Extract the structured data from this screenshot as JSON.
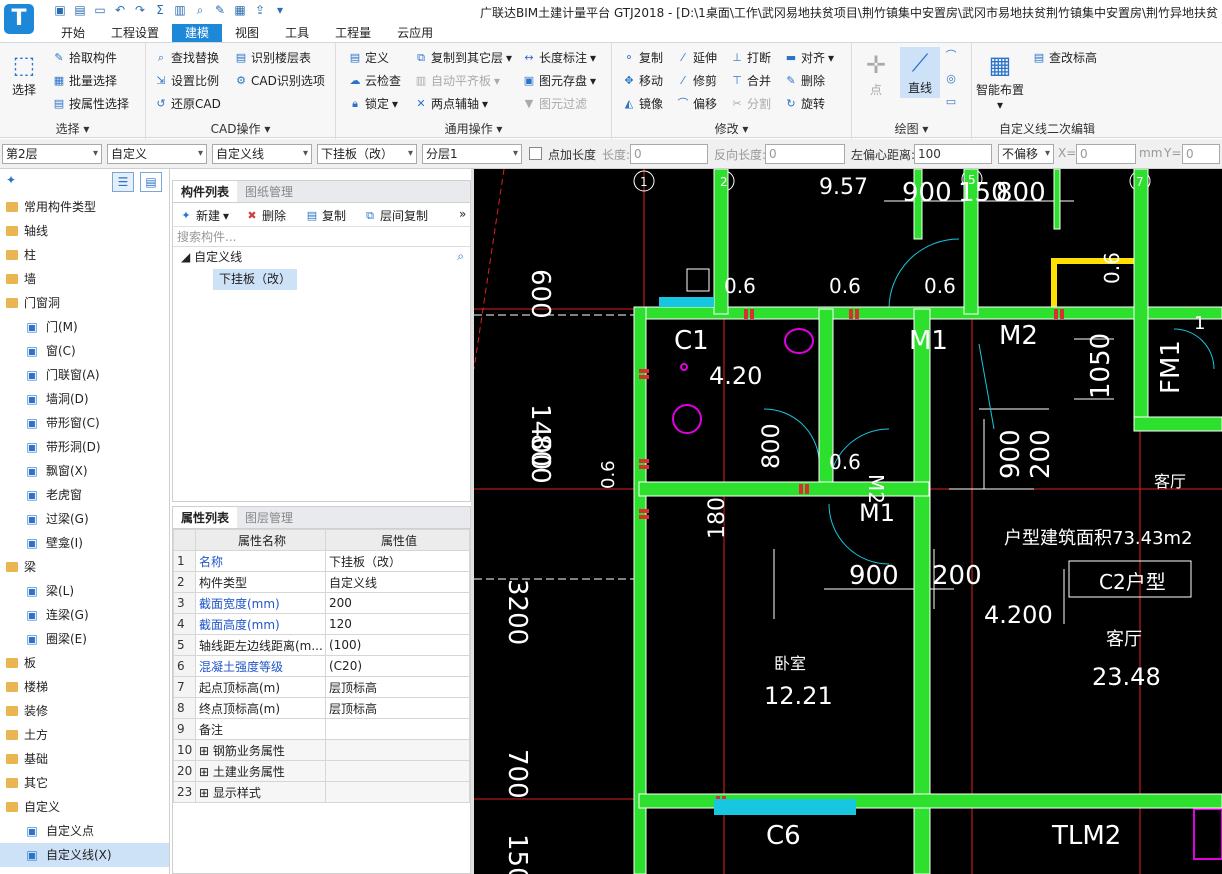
{
  "app": {
    "logo_letter": "T",
    "title": "广联达BIM土建计量平台 GTJ2018 - [D:\\1桌面\\工作\\武冈易地扶贫项目\\荆竹镇集中安置房\\武冈市易地扶贫荆竹镇集中安置房\\荆竹异地扶贫"
  },
  "menu": [
    "开始",
    "工程设置",
    "建模",
    "视图",
    "工具",
    "工程量",
    "云应用"
  ],
  "menu_active": "建模",
  "ribbon": {
    "select_group": {
      "label": "选择",
      "big": "选择",
      "items": [
        "拾取构件",
        "批量选择",
        "按属性选择"
      ]
    },
    "cad_group": {
      "label": "CAD操作",
      "items": [
        "查找替换",
        "识别楼层表",
        "设置比例",
        "CAD识别选项",
        "还原CAD"
      ]
    },
    "common_group": {
      "label": "通用操作",
      "items": [
        "定义",
        "复制到其它层",
        "长度标注",
        "云检查",
        "自动平齐板",
        "图元存盘",
        "锁定",
        "两点辅轴",
        "图元过滤"
      ]
    },
    "modify_group": {
      "label": "修改",
      "items": [
        "复制",
        "延伸",
        "打断",
        "对齐",
        "移动",
        "修剪",
        "合并",
        "删除",
        "镜像",
        "偏移",
        "分割",
        "旋转"
      ]
    },
    "draw_group": {
      "label": "绘图",
      "items": [
        "点",
        "直线"
      ]
    },
    "custom_group": {
      "label": "自定义线二次编辑",
      "items": [
        "智能布置",
        "查改标高"
      ]
    }
  },
  "propbar": {
    "floor": "第2层",
    "type": "自定义",
    "subtype": "自定义线",
    "component": "下挂板（改）",
    "layer": "分层1",
    "add_length_label": "点加长度",
    "length_label": "长度:",
    "length_value": "0",
    "reverse_label": "反向长度:",
    "reverse_value": "0",
    "offset_label": "左偏心距离:",
    "offset_value": "100",
    "no_offset": "不偏移",
    "x_label": "X=",
    "x_value": "0",
    "mm": "mm",
    "y_label": "Y=",
    "y_value": "0"
  },
  "nav": [
    {
      "label": "常用构件类型",
      "level": 0
    },
    {
      "label": "轴线",
      "level": 0
    },
    {
      "label": "柱",
      "level": 0
    },
    {
      "label": "墙",
      "level": 0
    },
    {
      "label": "门窗洞",
      "level": 0
    },
    {
      "label": "门(M)",
      "level": 1,
      "icon": "door-icon"
    },
    {
      "label": "窗(C)",
      "level": 1,
      "icon": "window-icon"
    },
    {
      "label": "门联窗(A)",
      "level": 1,
      "icon": "door-window-icon"
    },
    {
      "label": "墙洞(D)",
      "level": 1,
      "icon": "wall-hole-icon"
    },
    {
      "label": "带形窗(C)",
      "level": 1,
      "icon": "strip-window-icon"
    },
    {
      "label": "带形洞(D)",
      "level": 1,
      "icon": "strip-hole-icon"
    },
    {
      "label": "飘窗(X)",
      "level": 1,
      "icon": "bay-window-icon"
    },
    {
      "label": "老虎窗",
      "level": 1,
      "icon": "dormer-icon"
    },
    {
      "label": "过梁(G)",
      "level": 1,
      "icon": "lintel-icon"
    },
    {
      "label": "壁龛(I)",
      "level": 1,
      "icon": "niche-icon"
    },
    {
      "label": "梁",
      "level": 0
    },
    {
      "label": "梁(L)",
      "level": 1,
      "icon": "beam-icon"
    },
    {
      "label": "连梁(G)",
      "level": 1,
      "icon": "link-beam-icon"
    },
    {
      "label": "圈梁(E)",
      "level": 1,
      "icon": "ring-beam-icon"
    },
    {
      "label": "板",
      "level": 0
    },
    {
      "label": "楼梯",
      "level": 0
    },
    {
      "label": "装修",
      "level": 0
    },
    {
      "label": "土方",
      "level": 0
    },
    {
      "label": "基础",
      "level": 0
    },
    {
      "label": "其它",
      "level": 0
    },
    {
      "label": "自定义",
      "level": 0
    },
    {
      "label": "自定义点",
      "level": 1,
      "icon": "custom-point-icon"
    },
    {
      "label": "自定义线(X)",
      "level": 1,
      "icon": "custom-line-icon",
      "selected": true
    }
  ],
  "component_panel": {
    "tabs": [
      "构件列表",
      "图纸管理"
    ],
    "toolbar": [
      "新建",
      "删除",
      "复制",
      "层间复制"
    ],
    "search_placeholder": "搜索构件...",
    "tree_root": "自定义线",
    "tree_child": "下挂板（改）"
  },
  "property_panel": {
    "tabs": [
      "属性列表",
      "图层管理"
    ],
    "headers": [
      "属性名称",
      "属性值"
    ],
    "rows": [
      {
        "n": "1",
        "name": "名称",
        "value": "下挂板（改）",
        "blue": true
      },
      {
        "n": "2",
        "name": "构件类型",
        "value": "自定义线",
        "blue": false
      },
      {
        "n": "3",
        "name": "截面宽度(mm)",
        "value": "200",
        "blue": true
      },
      {
        "n": "4",
        "name": "截面高度(mm)",
        "value": "120",
        "blue": true
      },
      {
        "n": "5",
        "name": "轴线距左边线距离(m...",
        "value": "(100)",
        "blue": false
      },
      {
        "n": "6",
        "name": "混凝土强度等级",
        "value": "(C20)",
        "blue": true
      },
      {
        "n": "7",
        "name": "起点顶标高(m)",
        "value": "层顶标高",
        "blue": false
      },
      {
        "n": "8",
        "name": "终点顶标高(m)",
        "value": "层顶标高",
        "blue": false
      },
      {
        "n": "9",
        "name": "备注",
        "value": "",
        "blue": false
      },
      {
        "n": "10",
        "name": "钢筋业务属性",
        "value": "",
        "blue": false,
        "group": true
      },
      {
        "n": "20",
        "name": "土建业务属性",
        "value": "",
        "blue": false,
        "group": true
      },
      {
        "n": "23",
        "name": "显示样式",
        "value": "",
        "blue": false,
        "group": true
      }
    ]
  },
  "cad": {
    "axis_labels": [
      "1",
      "2",
      "5",
      "7"
    ],
    "texts": [
      "9.57",
      "900",
      "150",
      "800",
      "0.6",
      "0.6",
      "0.6",
      "0.6",
      "C1",
      "M1",
      "M2",
      "4.20",
      "800",
      "1400",
      "600",
      "1050",
      "FM1",
      "900",
      "200",
      "800",
      "0.6",
      "0.6",
      "客厅",
      "M1",
      "M2",
      "180",
      "户型建筑面积73.43m2",
      "C2户型",
      "900",
      "200",
      "4.200",
      "客厅",
      "23.48",
      "卧室",
      "12.21",
      "3200",
      "700",
      "C6",
      "TLM2",
      "1",
      "150"
    ]
  }
}
